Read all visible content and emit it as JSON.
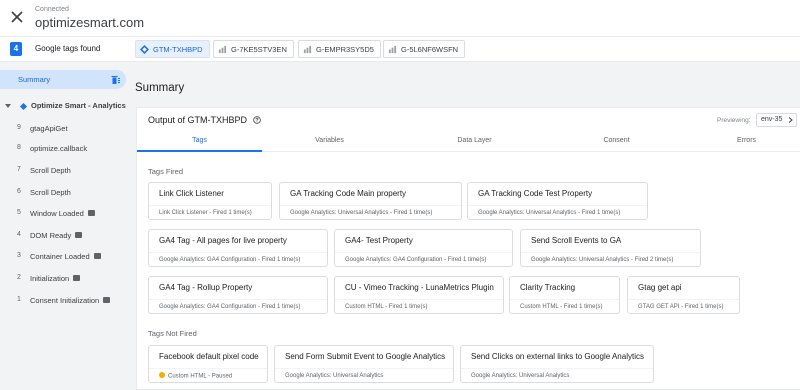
{
  "header": {
    "status": "Connected",
    "site": "optimizesmart.com"
  },
  "tagstrip": {
    "count": "4",
    "label": "Google tags found",
    "chips": [
      {
        "id": "GTM-TXHBPD",
        "active": true
      },
      {
        "id": "G-7KE5STV3EN",
        "active": false
      },
      {
        "id": "G-EMPR3SY5D5",
        "active": false
      },
      {
        "id": "G-5L6NF6WSFN",
        "active": false
      }
    ]
  },
  "sidebar": {
    "summary_label": "Summary",
    "container_label": "Optimize Smart - Analytics",
    "items": [
      {
        "num": "9",
        "label": "gtagApiGet",
        "badge": false
      },
      {
        "num": "8",
        "label": "optimize.callback",
        "badge": false
      },
      {
        "num": "7",
        "label": "Scroll Depth",
        "badge": false
      },
      {
        "num": "6",
        "label": "Scroll Depth",
        "badge": false
      },
      {
        "num": "5",
        "label": "Window Loaded",
        "badge": true
      },
      {
        "num": "4",
        "label": "DOM Ready",
        "badge": true
      },
      {
        "num": "3",
        "label": "Container Loaded",
        "badge": true
      },
      {
        "num": "2",
        "label": "Initialization",
        "badge": true
      },
      {
        "num": "1",
        "label": "Consent Initialization",
        "badge": true
      }
    ]
  },
  "main": {
    "title": "Summary",
    "output_title": "Output of GTM-TXHBPD",
    "previewing_label": "Previewing:",
    "env_value": "env-35",
    "tabs": [
      "Tags",
      "Variables",
      "Data Layer",
      "Consent",
      "Errors"
    ],
    "fired_label": "Tags Fired",
    "not_fired_label": "Tags Not Fired",
    "fired": [
      {
        "name": "Link Click Listener",
        "sub": "Link Click Listener - Fired 1 time(s)"
      },
      {
        "name": "GA Tracking Code Main property",
        "sub": "Google Analytics: Universal Analytics - Fired 1 time(s)"
      },
      {
        "name": "GA Tracking Code Test Property",
        "sub": "Google Analytics: Universal Analytics - Fired 1 time(s)"
      },
      {
        "name": "GA4 Tag - All pages for live property",
        "sub": "Google Analytics: GA4 Configuration - Fired 1 time(s)"
      },
      {
        "name": "GA4- Test Property",
        "sub": "Google Analytics: GA4 Configuration - Fired 1 time(s)"
      },
      {
        "name": "Send Scroll Events to GA",
        "sub": "Google Analytics: Universal Analytics - Fired 2 time(s)"
      },
      {
        "name": "GA4 Tag - Rollup Property",
        "sub": "Google Analytics: GA4 Configuration - Fired 1 time(s)"
      },
      {
        "name": "CU - Vimeo Tracking - LunaMetrics Plugin",
        "sub": "Custom HTML - Fired 1 time(s)"
      },
      {
        "name": "Clarity Tracking",
        "sub": "Custom HTML - Fired 1 time(s)"
      },
      {
        "name": "Gtag get api",
        "sub": "GTAG GET API - Fired 1 time(s)"
      }
    ],
    "not_fired": [
      {
        "name": "Facebook default pixel code",
        "sub": "Custom HTML - Paused",
        "warn": true
      },
      {
        "name": "Send Form Submit Event to Google Analytics",
        "sub": "Google Analytics: Universal Analytics",
        "warn": false
      },
      {
        "name": "Send Clicks on external links to Google Analytics",
        "sub": "Google Analytics: Universal Analytics",
        "warn": false
      }
    ]
  },
  "colors": {
    "accent": "#1a73e8",
    "sidebar_bg": "#f1f3f4",
    "active_chip_bg": "#e8f0fe",
    "warning": "#f9ab00"
  },
  "icons": [
    "close-icon",
    "tag-icon",
    "gtm-diamond-icon",
    "trash-icon",
    "help-icon",
    "chevron-down-icon",
    "caret-down-icon"
  ]
}
